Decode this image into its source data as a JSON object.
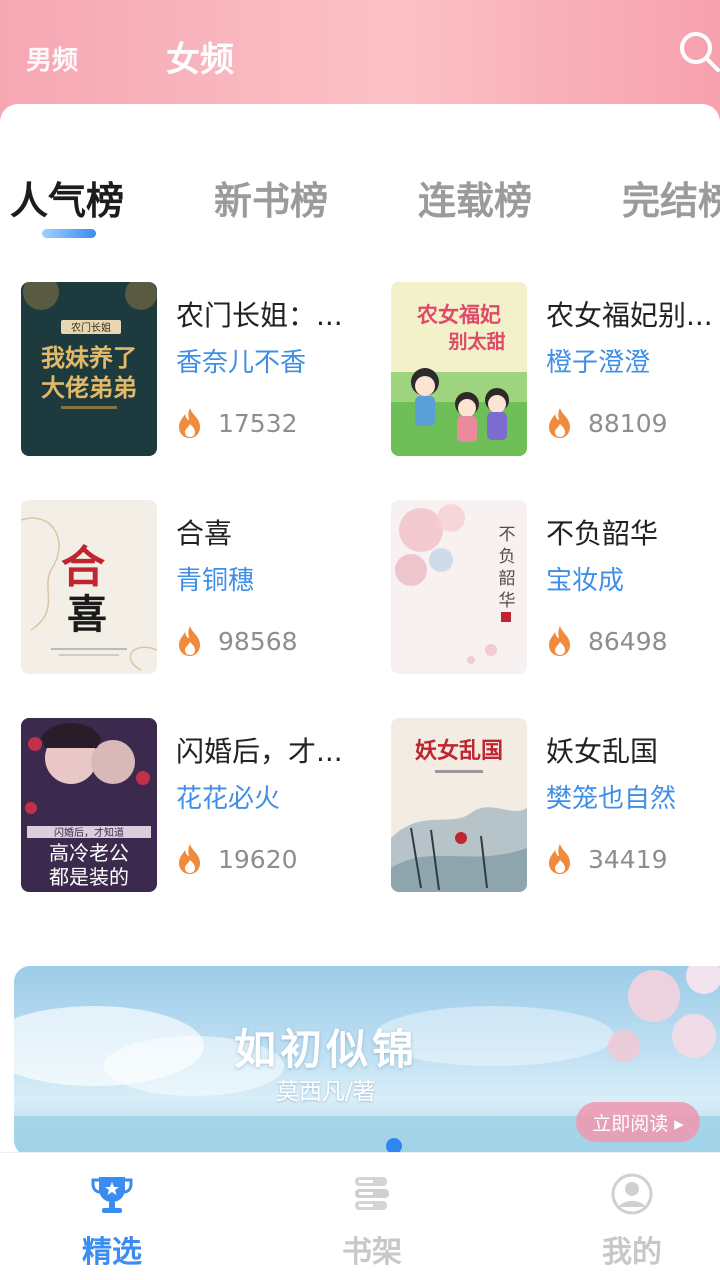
{
  "header": {
    "tabs": [
      "男频",
      "女频"
    ],
    "active_tab": "女频",
    "search_icon": "search-icon"
  },
  "rank_tabs": [
    "人气榜",
    "新书榜",
    "连载榜",
    "完结榜"
  ],
  "active_rank_tab": "人气榜",
  "books": [
    {
      "title": "农门长姐：...",
      "author": "香奈儿不香",
      "heat": "17532",
      "cover_text": [
        "农门长姐",
        "我妹养了",
        "大佬弟弟"
      ]
    },
    {
      "title": "农女福妃别...",
      "author": "橙子澄澄",
      "heat": "88109",
      "cover_text": [
        "农女福妃",
        "别太甜"
      ]
    },
    {
      "title": "合喜",
      "author": "青铜穗",
      "heat": "98568",
      "cover_text": [
        "合",
        "喜"
      ]
    },
    {
      "title": "不负韶华",
      "author": "宝妆成",
      "heat": "86498",
      "cover_text": [
        "不",
        "负",
        "韶",
        "华"
      ]
    },
    {
      "title": "闪婚后，才...",
      "author": "花花必火",
      "heat": "19620",
      "cover_text": [
        "闪婚后，才知道",
        "高冷老公",
        "都是装的"
      ]
    },
    {
      "title": "妖女乱国",
      "author": "樊笼也自然",
      "heat": "34419",
      "cover_text": [
        "妖女乱国"
      ]
    }
  ],
  "banner": {
    "title": "如初似锦",
    "author": "莫西凡/著",
    "button": "立即阅读 ▸"
  },
  "bottom_nav": [
    {
      "label": "精选",
      "icon": "trophy-icon",
      "active": true
    },
    {
      "label": "书架",
      "icon": "bookshelf-icon",
      "active": false
    },
    {
      "label": "我的",
      "icon": "profile-icon",
      "active": false
    }
  ],
  "colors": {
    "header_pink": "#f6a7b3",
    "accent_blue": "#3a8cf0",
    "author_blue": "#3f8fe8",
    "heat_orange": "#f08a3c"
  }
}
